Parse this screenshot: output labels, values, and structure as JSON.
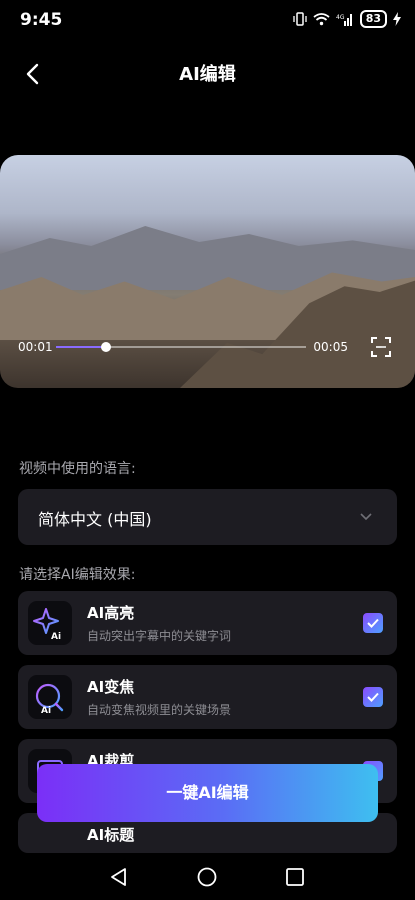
{
  "status_bar": {
    "time": "9:45",
    "battery": "83",
    "network": "4G"
  },
  "header": {
    "title": "AI编辑"
  },
  "video": {
    "current_time": "00:01",
    "end_time": "00:05",
    "progress": 0.2
  },
  "language": {
    "label": "视频中使用的语言:",
    "value": "简体中文 (中国)"
  },
  "effects": {
    "label": "请选择AI编辑效果:",
    "items": [
      {
        "title": "AI高亮",
        "desc": "自动突出字幕中的关键字词",
        "checked": true,
        "icon": "sparkle-ai-icon"
      },
      {
        "title": "AI变焦",
        "desc": "自动变焦视频里的关键场景",
        "checked": true,
        "icon": "zoom-ai-icon"
      },
      {
        "title": "AI裁剪",
        "desc": "",
        "checked": true,
        "icon": "crop-ai-icon"
      },
      {
        "title": "AI标题",
        "desc": "",
        "checked": true,
        "icon": "title-ai-icon"
      }
    ]
  },
  "cta": {
    "label": "一键AI编辑"
  },
  "colors": {
    "accent_start": "#7b2ff7",
    "accent_end": "#3ebff0",
    "card_bg": "#1d1c22"
  }
}
